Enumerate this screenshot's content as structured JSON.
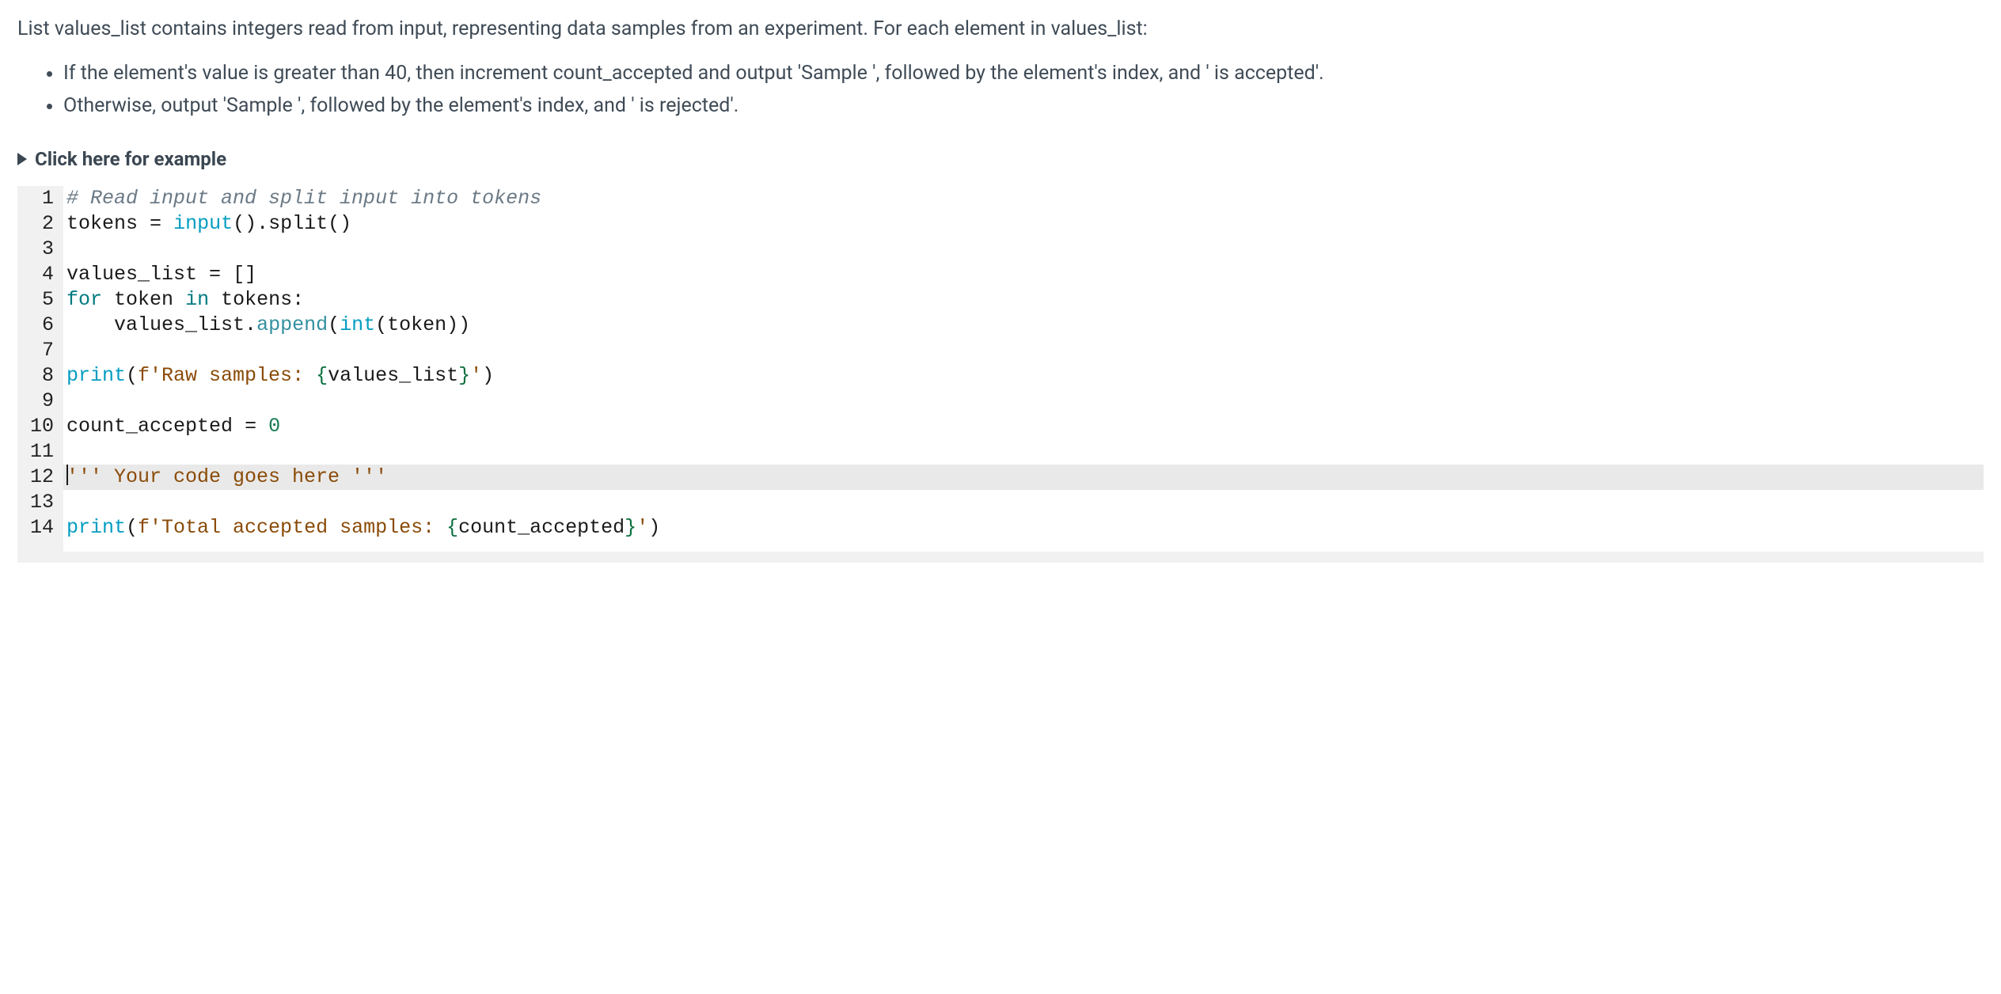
{
  "problem": {
    "intro": "List values_list contains integers read from input, representing data samples from an experiment. For each element in values_list:",
    "bullets": [
      "If the element's value is greater than 40, then increment count_accepted and output 'Sample ', followed by the element's index, and ' is accepted'.",
      "Otherwise, output 'Sample ', followed by the element's index, and ' is rejected'."
    ]
  },
  "example_toggle_label": "Click here for example",
  "code": {
    "lines": [
      {
        "n": "1",
        "editable": false,
        "tokens": [
          {
            "cls": "c-comment",
            "t": "# Read input and split input into tokens"
          }
        ]
      },
      {
        "n": "2",
        "editable": false,
        "tokens": [
          {
            "cls": "c-ident",
            "t": "tokens"
          },
          {
            "cls": "",
            "t": " "
          },
          {
            "cls": "c-op",
            "t": "="
          },
          {
            "cls": "",
            "t": " "
          },
          {
            "cls": "c-func",
            "t": "input"
          },
          {
            "cls": "c-paren",
            "t": "()"
          },
          {
            "cls": "c-op",
            "t": "."
          },
          {
            "cls": "c-ident",
            "t": "split"
          },
          {
            "cls": "c-paren",
            "t": "()"
          }
        ]
      },
      {
        "n": "3",
        "editable": false,
        "tokens": []
      },
      {
        "n": "4",
        "editable": false,
        "tokens": [
          {
            "cls": "c-ident",
            "t": "values_list"
          },
          {
            "cls": "",
            "t": " "
          },
          {
            "cls": "c-op",
            "t": "="
          },
          {
            "cls": "",
            "t": " "
          },
          {
            "cls": "c-paren",
            "t": "[]"
          }
        ]
      },
      {
        "n": "5",
        "editable": false,
        "tokens": [
          {
            "cls": "c-kw",
            "t": "for"
          },
          {
            "cls": "",
            "t": " "
          },
          {
            "cls": "c-ident",
            "t": "token"
          },
          {
            "cls": "",
            "t": " "
          },
          {
            "cls": "c-kw",
            "t": "in"
          },
          {
            "cls": "",
            "t": " "
          },
          {
            "cls": "c-ident",
            "t": "tokens"
          },
          {
            "cls": "c-op",
            "t": ":"
          }
        ]
      },
      {
        "n": "6",
        "editable": false,
        "tokens": [
          {
            "cls": "",
            "t": "    "
          },
          {
            "cls": "c-ident",
            "t": "values_list"
          },
          {
            "cls": "c-op",
            "t": "."
          },
          {
            "cls": "c-builtin",
            "t": "append"
          },
          {
            "cls": "c-paren",
            "t": "("
          },
          {
            "cls": "c-func",
            "t": "int"
          },
          {
            "cls": "c-paren",
            "t": "("
          },
          {
            "cls": "c-ident",
            "t": "token"
          },
          {
            "cls": "c-paren",
            "t": "))"
          }
        ]
      },
      {
        "n": "7",
        "editable": false,
        "tokens": []
      },
      {
        "n": "8",
        "editable": false,
        "tokens": [
          {
            "cls": "c-func",
            "t": "print"
          },
          {
            "cls": "c-paren",
            "t": "("
          },
          {
            "cls": "c-str",
            "t": "f'Raw samples: "
          },
          {
            "cls": "c-strph",
            "t": "{"
          },
          {
            "cls": "c-ident",
            "t": "values_list"
          },
          {
            "cls": "c-strph",
            "t": "}"
          },
          {
            "cls": "c-str",
            "t": "'"
          },
          {
            "cls": "c-paren",
            "t": ")"
          }
        ]
      },
      {
        "n": "9",
        "editable": false,
        "tokens": []
      },
      {
        "n": "10",
        "editable": false,
        "tokens": [
          {
            "cls": "c-ident",
            "t": "count_accepted"
          },
          {
            "cls": "",
            "t": " "
          },
          {
            "cls": "c-op",
            "t": "="
          },
          {
            "cls": "",
            "t": " "
          },
          {
            "cls": "c-num",
            "t": "0"
          }
        ]
      },
      {
        "n": "11",
        "editable": false,
        "tokens": []
      },
      {
        "n": "12",
        "editable": true,
        "cursor": true,
        "tokens": [
          {
            "cls": "c-str",
            "t": "''' Your code goes here '''"
          }
        ]
      },
      {
        "n": "13",
        "editable": false,
        "tokens": []
      },
      {
        "n": "14",
        "editable": false,
        "tokens": [
          {
            "cls": "c-func",
            "t": "print"
          },
          {
            "cls": "c-paren",
            "t": "("
          },
          {
            "cls": "c-str",
            "t": "f'Total accepted samples: "
          },
          {
            "cls": "c-strph",
            "t": "{"
          },
          {
            "cls": "c-ident",
            "t": "count_accepted"
          },
          {
            "cls": "c-strph",
            "t": "}"
          },
          {
            "cls": "c-str",
            "t": "'"
          },
          {
            "cls": "c-paren",
            "t": ")"
          }
        ]
      }
    ]
  }
}
